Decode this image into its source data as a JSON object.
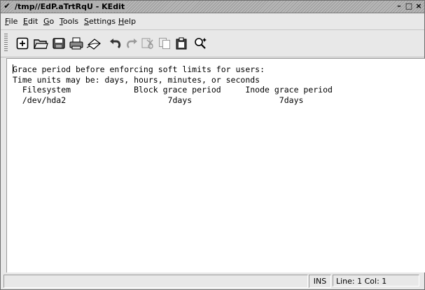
{
  "window": {
    "title": "/tmp//EdP.aTrtRqU - KEdit",
    "menu_glyph": "✔",
    "minimize_glyph": "–",
    "maximize_glyph": "□",
    "close_glyph": "×"
  },
  "menubar": {
    "items": [
      "File",
      "Edit",
      "Go",
      "Tools",
      "Settings",
      "Help"
    ]
  },
  "toolbar": {
    "icons": [
      "new-document-icon",
      "open-folder-icon",
      "save-icon",
      "print-icon",
      "mail-icon",
      "undo-icon",
      "redo-icon",
      "cut-icon",
      "copy-icon",
      "paste-icon",
      "find-icon"
    ]
  },
  "editor": {
    "lines": [
      "Grace period before enforcing soft limits for users:",
      "Time units may be: days, hours, minutes, or seconds",
      "  Filesystem             Block grace period     Inode grace period",
      "  /dev/hda2                     7days                  7days"
    ]
  },
  "statusbar": {
    "message": "",
    "mode": "INS",
    "position": "Line: 1 Col: 1"
  }
}
